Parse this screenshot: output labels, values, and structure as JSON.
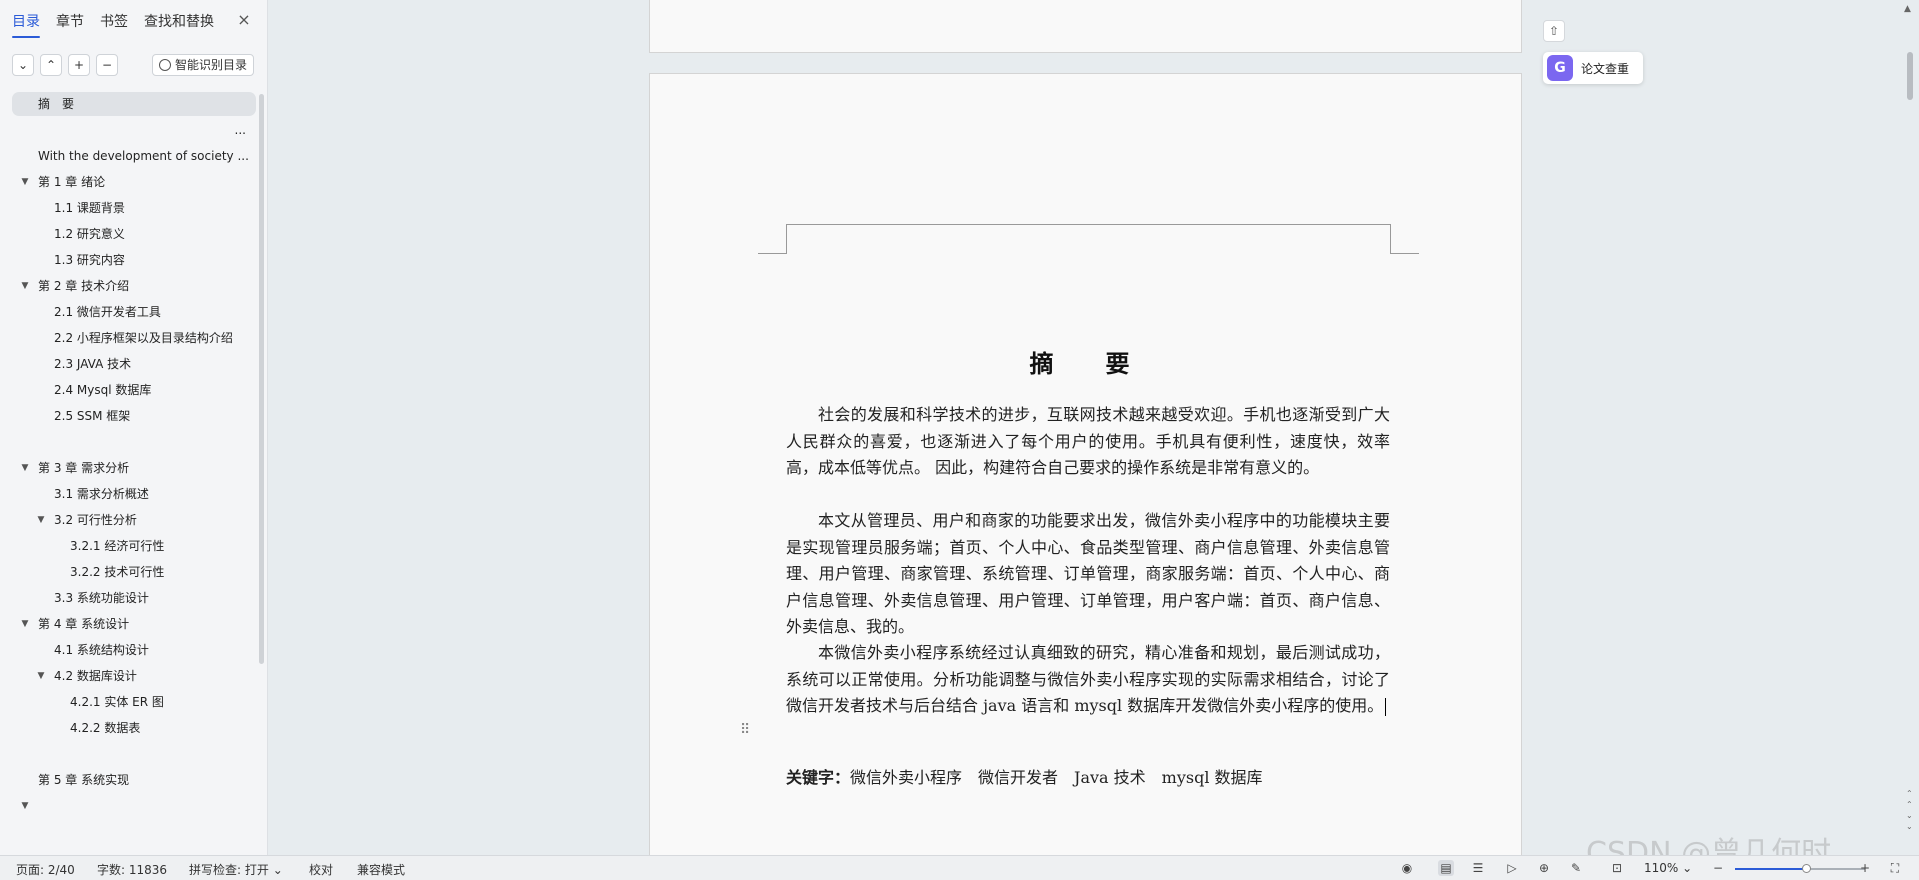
{
  "nav": {
    "tabs": [
      {
        "label": "目录",
        "active": true
      },
      {
        "label": "章节",
        "active": false
      },
      {
        "label": "书签",
        "active": false
      },
      {
        "label": "查找和替换",
        "active": false
      }
    ],
    "close_icon": "×",
    "toolbar": {
      "collapse_all": "⌄",
      "expand_up": "⌃",
      "add": "+",
      "remove": "−",
      "smart_label": "智能识别目录"
    },
    "toc": [
      {
        "label": "摘　要",
        "level": 1,
        "selected": true
      },
      {
        "label": "...",
        "level": 0
      },
      {
        "label": "With the development of society ...",
        "level": 1
      },
      {
        "label": "第 1 章  绪论",
        "level": 1,
        "caret": true
      },
      {
        "label": "1.1 课题背景",
        "level": 2
      },
      {
        "label": "1.2 研究意义",
        "level": 2
      },
      {
        "label": "1.3 研究内容",
        "level": 2
      },
      {
        "label": "第 2 章  技术介绍",
        "level": 1,
        "caret": true
      },
      {
        "label": "2.1 微信开发者工具",
        "level": 2
      },
      {
        "label": "2.2 小程序框架以及目录结构介绍",
        "level": 2
      },
      {
        "label": "2.3 JAVA 技术",
        "level": 2
      },
      {
        "label": "2.4    Mysql 数据库",
        "level": 2
      },
      {
        "label": "2.5 SSM 框架",
        "level": 2
      },
      {
        "label": "",
        "level": 0
      },
      {
        "label": "第 3 章  需求分析",
        "level": 1,
        "caret": true
      },
      {
        "label": "3.1 需求分析概述",
        "level": 2
      },
      {
        "label": "3.2 可行性分析",
        "level": 2,
        "caret": true
      },
      {
        "label": "3.2.1 经济可行性",
        "level": 3
      },
      {
        "label": "3.2.2 技术可行性",
        "level": 3
      },
      {
        "label": "3.3 系统功能设计",
        "level": 2
      },
      {
        "label": "第 4 章  系统设计",
        "level": 1,
        "caret": true
      },
      {
        "label": "4.1 系统结构设计",
        "level": 2
      },
      {
        "label": "4.2 数据库设计",
        "level": 2,
        "caret": true
      },
      {
        "label": "4.2.1 实体 ER 图",
        "level": 3
      },
      {
        "label": "4.2.2 数据表",
        "level": 3
      },
      {
        "label": "",
        "level": 0
      },
      {
        "label": "第 5 章  系统实现",
        "level": 1
      },
      {
        "label": "",
        "level": 0,
        "caret": true
      }
    ]
  },
  "doc": {
    "title": "摘　要",
    "paragraphs": [
      "社会的发展和科学技术的进步，互联网技术越来越受欢迎。手机也逐渐受到广大人民群众的喜爱，也逐渐进入了每个用户的使用。手机具有便利性，速度快，效率高，成本低等优点。 因此，构建符合自己要求的操作系统是非常有意义的。",
      "本文从管理员、用户和商家的功能要求出发，微信外卖小程序中的功能模块主要是实现管理员服务端；首页、个人中心、食品类型管理、商户信息管理、外卖信息管理、用户管理、商家管理、系统管理、订单管理，商家服务端：首页、个人中心、商户信息管理、外卖信息管理、用户管理、订单管理，用户客户端：首页、商户信息、外卖信息、我的。",
      "本微信外卖小程序系统经过认真细致的研究，精心准备和规划，最后测试成功，系统可以正常使用。分析功能调整与微信外卖小程序实现的实际需求相结合，讨论了微信开发者技术与后台结合 java 语言和 mysql 数据库开发微信外卖小程序的使用。"
    ],
    "keywords_label": "关键字：",
    "keywords": [
      "微信外卖小程序",
      "微信开发者",
      "Java 技术",
      "mysql 数据库"
    ],
    "drag_handle_icon": "⠿"
  },
  "right_tools": {
    "collapse_icon": "⇧",
    "check_label": "论文查重",
    "check_icon": "G"
  },
  "watermark": "CSDN @曾几何时…",
  "status": {
    "page": "页面: 2/40",
    "words": "字数: 11836",
    "spell": "拼写检查: 打开",
    "proof": "校对",
    "compat": "兼容模式",
    "zoom": "110%",
    "zoom_fraction": 0.55
  },
  "colors": {
    "accent": "#2b5bd7",
    "check_icon_bg": "#7b67f0"
  }
}
